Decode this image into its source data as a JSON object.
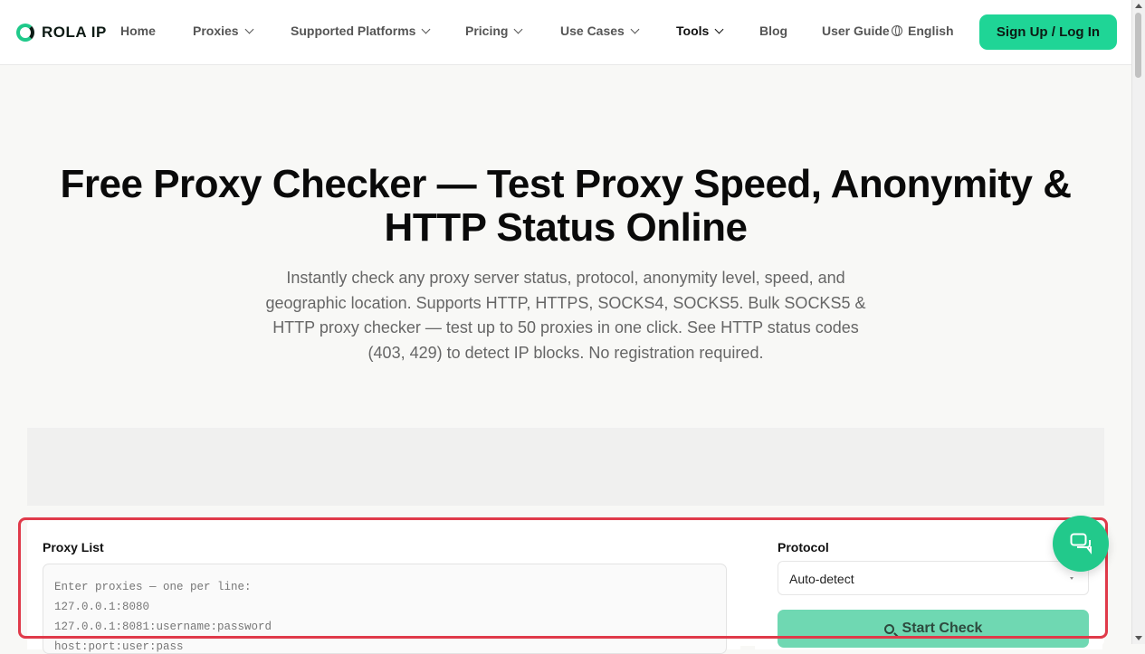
{
  "header": {
    "logo_text": "ROLA IP",
    "nav": [
      {
        "label": "Home",
        "dropdown": false
      },
      {
        "label": "Proxies",
        "dropdown": true
      },
      {
        "label": "Supported Platforms",
        "dropdown": true
      },
      {
        "label": "Pricing",
        "dropdown": true
      },
      {
        "label": "Use Cases",
        "dropdown": true
      },
      {
        "label": "Tools",
        "dropdown": true,
        "active": true
      },
      {
        "label": "Blog",
        "dropdown": false
      },
      {
        "label": "User Guide",
        "dropdown": false
      }
    ],
    "language": "English",
    "signup_label": "Sign Up / Log In"
  },
  "hero": {
    "title": "Free Proxy Checker — Test Proxy Speed, Anonymity & HTTP Status Online",
    "subtitle": "Instantly check any proxy server status, protocol, anonymity level, speed, and geographic location. Supports HTTP, HTTPS, SOCKS4, SOCKS5. Bulk SOCKS5 & HTTP proxy checker — test up to 50 proxies in one click. See HTTP status codes (403, 429) to detect IP blocks. No registration required."
  },
  "checker": {
    "proxy_list_label": "Proxy List",
    "proxy_list_placeholder": "Enter proxies — one per line:\n127.0.0.1:8080\n127.0.0.1:8081:username:password\nhost:port:user:pass",
    "protocol_label": "Protocol",
    "protocol_value": "Auto-detect",
    "start_label": "Start Check"
  },
  "colors": {
    "accent": "#1fd596",
    "highlight_outline": "#e03a4a"
  }
}
